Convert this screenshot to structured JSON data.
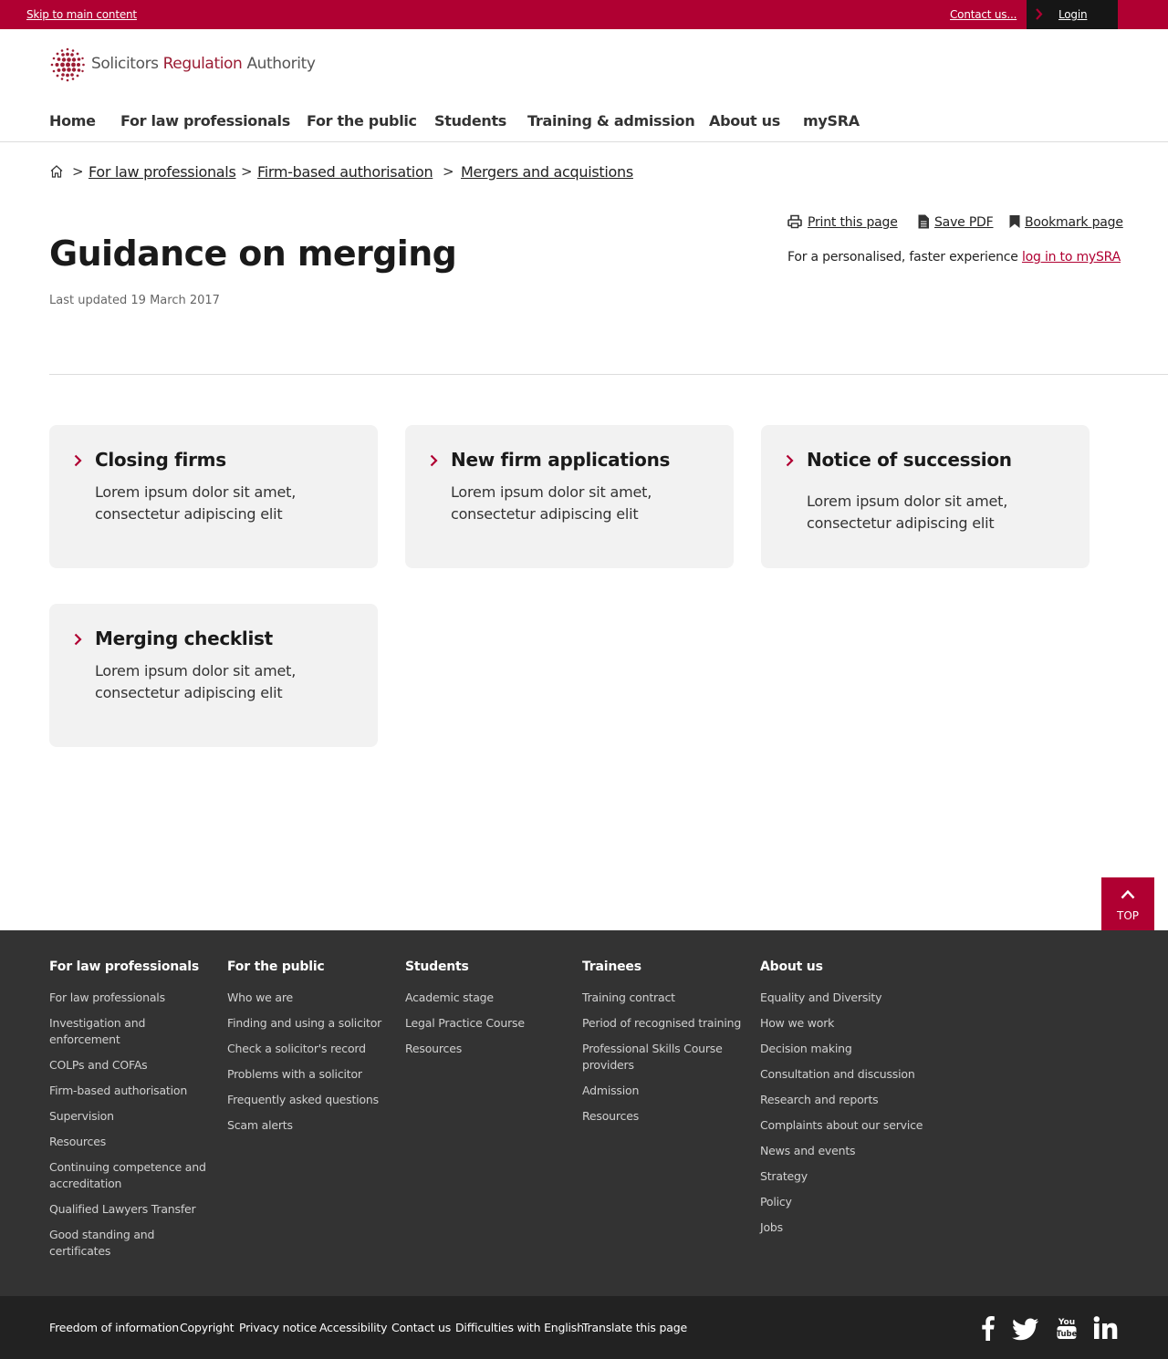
{
  "topbar": {
    "skip_label": "Skip to main content",
    "contact_label": "Contact us...",
    "login_label": "Login"
  },
  "logo": {
    "word1": "Solicitors",
    "word2": "Regulation",
    "word3": "Authority"
  },
  "nav": {
    "items": [
      "Home",
      "For law professionals",
      "For the public",
      "Students",
      "Training & admission",
      "About us",
      "mySRA"
    ]
  },
  "breadcrumb": {
    "items": [
      "For law professionals",
      "Firm-based authorisation",
      "Mergers and acquistions"
    ],
    "separator": ">"
  },
  "page": {
    "title": "Guidance on merging",
    "updated": "Last updated 19 March 2017"
  },
  "tools": {
    "print": "Print this page",
    "pdf": "Save PDF",
    "bookmark": "Bookmark page",
    "personal_text": "For a personalised, faster experience ",
    "personal_link": "log in to mySRA"
  },
  "cards": [
    {
      "title": "Closing firms",
      "text": "Lorem ipsum dolor sit amet, consectetur adipiscing elit"
    },
    {
      "title": "New firm applications",
      "text": "Lorem ipsum dolor sit amet, consectetur adipiscing elit"
    },
    {
      "title": "Notice of succession",
      "text": "Lorem ipsum dolor sit amet, consectetur adipiscing elit"
    },
    {
      "title": "Merging checklist",
      "text": "Lorem ipsum dolor sit amet, consectetur adipiscing elit"
    }
  ],
  "totop": {
    "label": "TOP"
  },
  "footer": {
    "columns": [
      {
        "heading": "For law professionals",
        "links": [
          "For law professionals",
          "Investigation and enforcement",
          "COLPs and COFAs",
          "Firm-based authorisation",
          "Supervision",
          "Resources",
          "Continuing competence and accreditation",
          "Qualified Lawyers Transfer",
          "Good standing and certificates"
        ]
      },
      {
        "heading": "For the public",
        "links": [
          "Who we are",
          "Finding and using a solicitor",
          "Check a solicitor's record",
          "Problems with a solicitor",
          "Frequently asked questions",
          "Scam alerts"
        ]
      },
      {
        "heading": "Students",
        "links": [
          "Academic stage",
          "Legal Practice Course",
          "Resources"
        ]
      },
      {
        "heading": "Trainees",
        "links": [
          "Training contract",
          "Period of recognised training",
          "Professional Skills Course providers",
          "Admission",
          "Resources"
        ]
      },
      {
        "heading": "About us",
        "links": [
          "Equality and Diversity",
          "How we work",
          "Decision making",
          "Consultation and discussion",
          "Research and reports",
          "Complaints about our service",
          "News and events",
          "Strategy",
          "Policy",
          "Jobs"
        ]
      }
    ],
    "legal_links": [
      "Freedom of information",
      "Copyright",
      "Privacy notice",
      "Accessibility",
      "Contact us",
      "Difficulties with English",
      "Translate this page"
    ],
    "social": [
      "facebook-icon",
      "twitter-icon",
      "youtube-icon",
      "linkedin-icon"
    ]
  },
  "colors": {
    "brand_red": "#b00032",
    "footer_bg": "#333333",
    "subfooter_bg": "#222222",
    "card_bg": "#f2f2f2"
  }
}
